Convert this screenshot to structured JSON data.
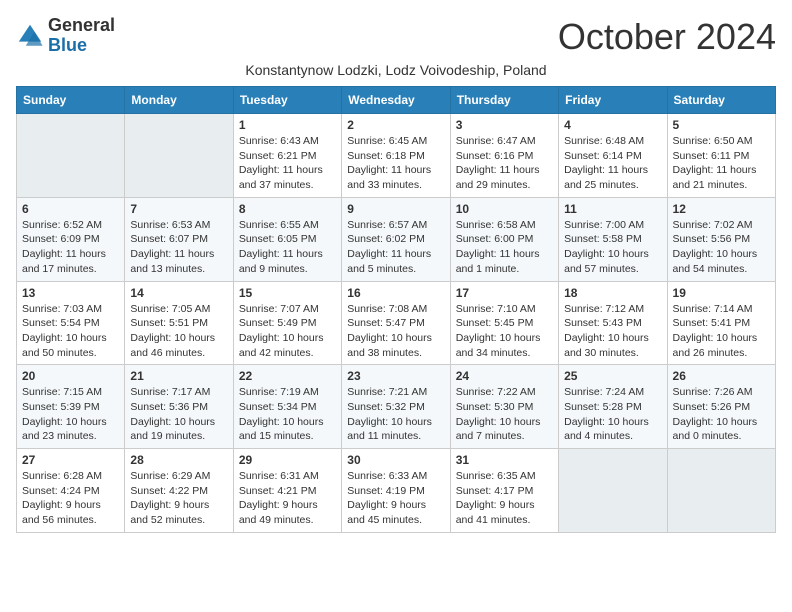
{
  "header": {
    "logo_general": "General",
    "logo_blue": "Blue",
    "title": "October 2024",
    "subtitle": "Konstantynow Lodzki, Lodz Voivodeship, Poland"
  },
  "weekdays": [
    "Sunday",
    "Monday",
    "Tuesday",
    "Wednesday",
    "Thursday",
    "Friday",
    "Saturday"
  ],
  "weeks": [
    [
      {
        "day": "",
        "info": ""
      },
      {
        "day": "",
        "info": ""
      },
      {
        "day": "1",
        "info": "Sunrise: 6:43 AM\nSunset: 6:21 PM\nDaylight: 11 hours and 37 minutes."
      },
      {
        "day": "2",
        "info": "Sunrise: 6:45 AM\nSunset: 6:18 PM\nDaylight: 11 hours and 33 minutes."
      },
      {
        "day": "3",
        "info": "Sunrise: 6:47 AM\nSunset: 6:16 PM\nDaylight: 11 hours and 29 minutes."
      },
      {
        "day": "4",
        "info": "Sunrise: 6:48 AM\nSunset: 6:14 PM\nDaylight: 11 hours and 25 minutes."
      },
      {
        "day": "5",
        "info": "Sunrise: 6:50 AM\nSunset: 6:11 PM\nDaylight: 11 hours and 21 minutes."
      }
    ],
    [
      {
        "day": "6",
        "info": "Sunrise: 6:52 AM\nSunset: 6:09 PM\nDaylight: 11 hours and 17 minutes."
      },
      {
        "day": "7",
        "info": "Sunrise: 6:53 AM\nSunset: 6:07 PM\nDaylight: 11 hours and 13 minutes."
      },
      {
        "day": "8",
        "info": "Sunrise: 6:55 AM\nSunset: 6:05 PM\nDaylight: 11 hours and 9 minutes."
      },
      {
        "day": "9",
        "info": "Sunrise: 6:57 AM\nSunset: 6:02 PM\nDaylight: 11 hours and 5 minutes."
      },
      {
        "day": "10",
        "info": "Sunrise: 6:58 AM\nSunset: 6:00 PM\nDaylight: 11 hours and 1 minute."
      },
      {
        "day": "11",
        "info": "Sunrise: 7:00 AM\nSunset: 5:58 PM\nDaylight: 10 hours and 57 minutes."
      },
      {
        "day": "12",
        "info": "Sunrise: 7:02 AM\nSunset: 5:56 PM\nDaylight: 10 hours and 54 minutes."
      }
    ],
    [
      {
        "day": "13",
        "info": "Sunrise: 7:03 AM\nSunset: 5:54 PM\nDaylight: 10 hours and 50 minutes."
      },
      {
        "day": "14",
        "info": "Sunrise: 7:05 AM\nSunset: 5:51 PM\nDaylight: 10 hours and 46 minutes."
      },
      {
        "day": "15",
        "info": "Sunrise: 7:07 AM\nSunset: 5:49 PM\nDaylight: 10 hours and 42 minutes."
      },
      {
        "day": "16",
        "info": "Sunrise: 7:08 AM\nSunset: 5:47 PM\nDaylight: 10 hours and 38 minutes."
      },
      {
        "day": "17",
        "info": "Sunrise: 7:10 AM\nSunset: 5:45 PM\nDaylight: 10 hours and 34 minutes."
      },
      {
        "day": "18",
        "info": "Sunrise: 7:12 AM\nSunset: 5:43 PM\nDaylight: 10 hours and 30 minutes."
      },
      {
        "day": "19",
        "info": "Sunrise: 7:14 AM\nSunset: 5:41 PM\nDaylight: 10 hours and 26 minutes."
      }
    ],
    [
      {
        "day": "20",
        "info": "Sunrise: 7:15 AM\nSunset: 5:39 PM\nDaylight: 10 hours and 23 minutes."
      },
      {
        "day": "21",
        "info": "Sunrise: 7:17 AM\nSunset: 5:36 PM\nDaylight: 10 hours and 19 minutes."
      },
      {
        "day": "22",
        "info": "Sunrise: 7:19 AM\nSunset: 5:34 PM\nDaylight: 10 hours and 15 minutes."
      },
      {
        "day": "23",
        "info": "Sunrise: 7:21 AM\nSunset: 5:32 PM\nDaylight: 10 hours and 11 minutes."
      },
      {
        "day": "24",
        "info": "Sunrise: 7:22 AM\nSunset: 5:30 PM\nDaylight: 10 hours and 7 minutes."
      },
      {
        "day": "25",
        "info": "Sunrise: 7:24 AM\nSunset: 5:28 PM\nDaylight: 10 hours and 4 minutes."
      },
      {
        "day": "26",
        "info": "Sunrise: 7:26 AM\nSunset: 5:26 PM\nDaylight: 10 hours and 0 minutes."
      }
    ],
    [
      {
        "day": "27",
        "info": "Sunrise: 6:28 AM\nSunset: 4:24 PM\nDaylight: 9 hours and 56 minutes."
      },
      {
        "day": "28",
        "info": "Sunrise: 6:29 AM\nSunset: 4:22 PM\nDaylight: 9 hours and 52 minutes."
      },
      {
        "day": "29",
        "info": "Sunrise: 6:31 AM\nSunset: 4:21 PM\nDaylight: 9 hours and 49 minutes."
      },
      {
        "day": "30",
        "info": "Sunrise: 6:33 AM\nSunset: 4:19 PM\nDaylight: 9 hours and 45 minutes."
      },
      {
        "day": "31",
        "info": "Sunrise: 6:35 AM\nSunset: 4:17 PM\nDaylight: 9 hours and 41 minutes."
      },
      {
        "day": "",
        "info": ""
      },
      {
        "day": "",
        "info": ""
      }
    ]
  ]
}
